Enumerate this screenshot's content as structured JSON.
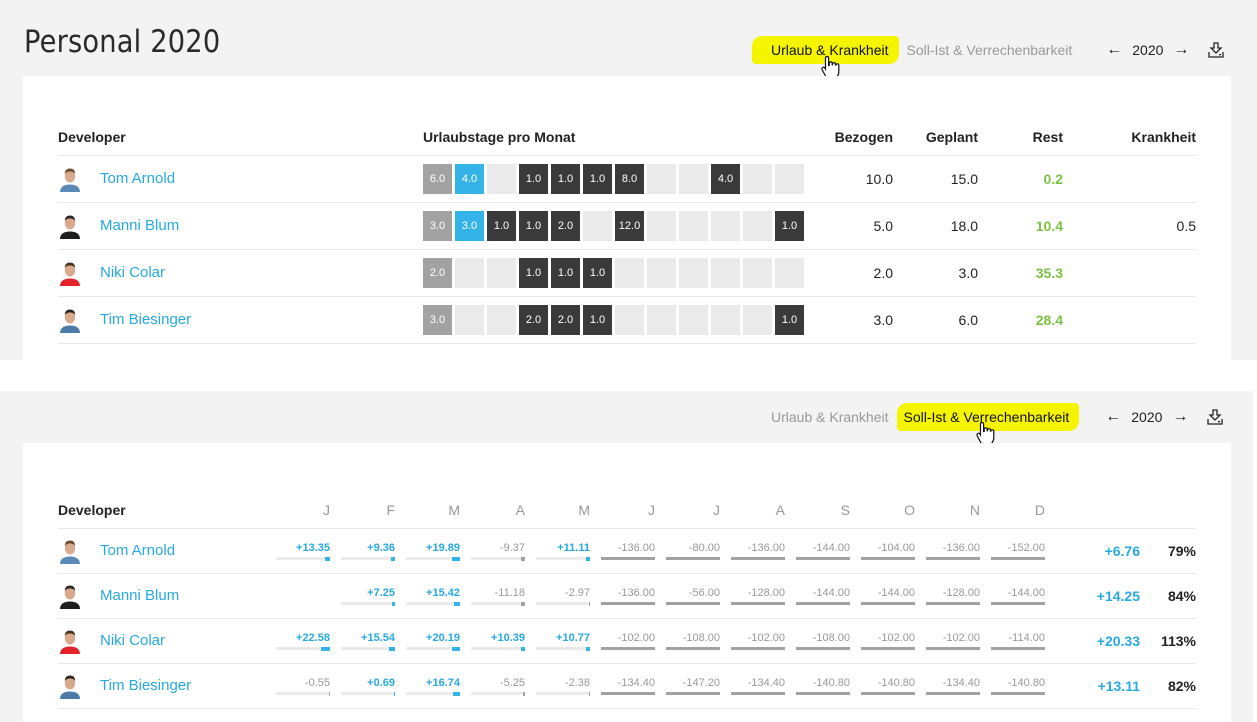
{
  "page": {
    "title": "Personal 2020"
  },
  "colors": {
    "accent": "#27a9e1",
    "highlight": "#f5f500",
    "rest_green": "#7cc242",
    "planned": "#3a3a3a",
    "past": "#a2a2a2",
    "current": "#34b3e8"
  },
  "toolbar": {
    "tabs": [
      {
        "label": "Urlaub & Krankheit"
      },
      {
        "label": "Soll-Ist & Verrechenbarkeit"
      }
    ],
    "year": "2020",
    "prev_icon": "arrow-left-icon",
    "next_icon": "arrow-right-icon",
    "download_icon": "download-icon",
    "prev_glyph": "←",
    "next_glyph": "→"
  },
  "vacation": {
    "active_tab": "Urlaub & Krankheit",
    "headers": {
      "developer": "Developer",
      "months": "Urlaubstage pro Monat",
      "bezogen": "Bezogen",
      "geplant": "Geplant",
      "rest": "Rest",
      "krankheit": "Krankheit"
    },
    "rows": [
      {
        "name": "Tom Arnold",
        "months": [
          {
            "v": "6.0",
            "t": "past"
          },
          {
            "v": "4.0",
            "t": "current"
          },
          {
            "v": "",
            "t": "empty"
          },
          {
            "v": "1.0",
            "t": "planned"
          },
          {
            "v": "1.0",
            "t": "planned"
          },
          {
            "v": "1.0",
            "t": "planned"
          },
          {
            "v": "8.0",
            "t": "planned"
          },
          {
            "v": "",
            "t": "empty"
          },
          {
            "v": "",
            "t": "empty"
          },
          {
            "v": "4.0",
            "t": "planned"
          },
          {
            "v": "",
            "t": "empty"
          },
          {
            "v": "",
            "t": "empty"
          }
        ],
        "bezogen": "10.0",
        "geplant": "15.0",
        "rest": "0.2",
        "krankheit": ""
      },
      {
        "name": "Manni Blum",
        "months": [
          {
            "v": "3.0",
            "t": "past"
          },
          {
            "v": "3.0",
            "t": "current"
          },
          {
            "v": "1.0",
            "t": "planned"
          },
          {
            "v": "1.0",
            "t": "planned"
          },
          {
            "v": "2.0",
            "t": "planned"
          },
          {
            "v": "",
            "t": "empty"
          },
          {
            "v": "12.0",
            "t": "planned"
          },
          {
            "v": "",
            "t": "empty"
          },
          {
            "v": "",
            "t": "empty"
          },
          {
            "v": "",
            "t": "empty"
          },
          {
            "v": "",
            "t": "empty"
          },
          {
            "v": "1.0",
            "t": "planned"
          }
        ],
        "bezogen": "5.0",
        "geplant": "18.0",
        "rest": "10.4",
        "krankheit": "0.5"
      },
      {
        "name": "Niki Colar",
        "months": [
          {
            "v": "2.0",
            "t": "past"
          },
          {
            "v": "",
            "t": "empty"
          },
          {
            "v": "",
            "t": "empty"
          },
          {
            "v": "1.0",
            "t": "planned"
          },
          {
            "v": "1.0",
            "t": "planned"
          },
          {
            "v": "1.0",
            "t": "planned"
          },
          {
            "v": "",
            "t": "empty"
          },
          {
            "v": "",
            "t": "empty"
          },
          {
            "v": "",
            "t": "empty"
          },
          {
            "v": "",
            "t": "empty"
          },
          {
            "v": "",
            "t": "empty"
          },
          {
            "v": "",
            "t": "empty"
          }
        ],
        "bezogen": "2.0",
        "geplant": "3.0",
        "rest": "35.3",
        "krankheit": ""
      },
      {
        "name": "Tim Biesinger",
        "months": [
          {
            "v": "3.0",
            "t": "past"
          },
          {
            "v": "",
            "t": "empty"
          },
          {
            "v": "",
            "t": "empty"
          },
          {
            "v": "2.0",
            "t": "planned"
          },
          {
            "v": "2.0",
            "t": "planned"
          },
          {
            "v": "1.0",
            "t": "planned"
          },
          {
            "v": "",
            "t": "empty"
          },
          {
            "v": "",
            "t": "empty"
          },
          {
            "v": "",
            "t": "empty"
          },
          {
            "v": "",
            "t": "empty"
          },
          {
            "v": "",
            "t": "empty"
          },
          {
            "v": "1.0",
            "t": "planned"
          }
        ],
        "bezogen": "3.0",
        "geplant": "6.0",
        "rest": "28.4",
        "krankheit": ""
      }
    ]
  },
  "billing": {
    "active_tab": "Soll-Ist & Verrechenbarkeit",
    "headers": {
      "developer": "Developer",
      "months": [
        "J",
        "F",
        "M",
        "A",
        "M",
        "J",
        "J",
        "A",
        "S",
        "O",
        "N",
        "D"
      ]
    },
    "rows": [
      {
        "name": "Tom Arnold",
        "months": [
          "+13.35",
          "+9.36",
          "+19.89",
          "-9.37",
          "+11.11",
          "-136.00",
          "-80.00",
          "-136.00",
          "-144.00",
          "-104.00",
          "-136.00",
          "-152.00"
        ],
        "total": "+6.76",
        "percent": "79%"
      },
      {
        "name": "Manni Blum",
        "months": [
          "",
          "+7.25",
          "+15.42",
          "-11.18",
          "-2.97",
          "-136.00",
          "-56.00",
          "-128.00",
          "-144.00",
          "-144.00",
          "-128.00",
          "-144.00"
        ],
        "total": "+14.25",
        "percent": "84%"
      },
      {
        "name": "Niki Colar",
        "months": [
          "+22.58",
          "+15.54",
          "+20.19",
          "+10.39",
          "+10.77",
          "-102.00",
          "-108.00",
          "-102.00",
          "-108.00",
          "-102.00",
          "-102.00",
          "-114.00"
        ],
        "total": "+20.33",
        "percent": "113%"
      },
      {
        "name": "Tim Biesinger",
        "months": [
          "-0.55",
          "+0.69",
          "+16.74",
          "-5.25",
          "-2.38",
          "-134.40",
          "-147.20",
          "-134.40",
          "-140.80",
          "-140.80",
          "-134.40",
          "-140.80"
        ],
        "total": "+13.11",
        "percent": "82%"
      }
    ]
  }
}
